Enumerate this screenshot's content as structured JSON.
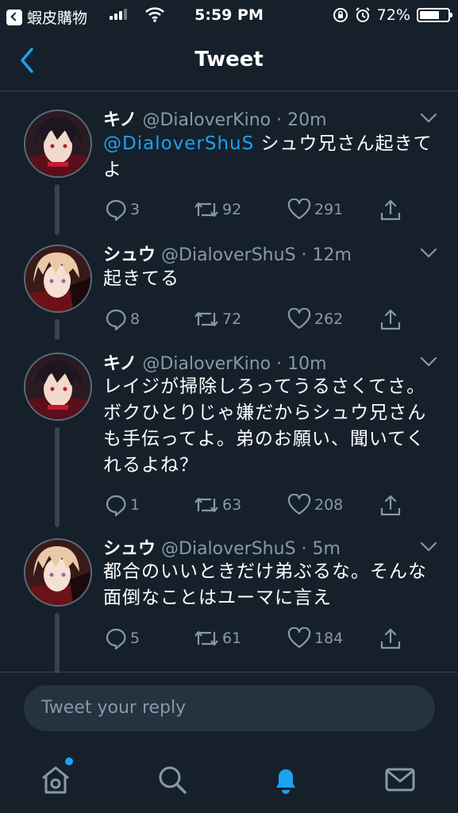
{
  "status_bar": {
    "back_app": "蝦皮購物",
    "time": "5:59 PM",
    "battery": "72%",
    "battery_level": 0.72
  },
  "header": {
    "title": "Tweet"
  },
  "tweets": [
    {
      "name": "キノ",
      "handle": "@DialoverKino",
      "time": "· 20m",
      "mention": "@DialoverShuS",
      "text": " シュウ兄さん起きてよ",
      "replies": "3",
      "retweets": "92",
      "likes": "291"
    },
    {
      "name": "シュウ",
      "handle": "@DialoverShuS",
      "time": "· 12m",
      "mention": "",
      "text": "起きてる",
      "replies": "8",
      "retweets": "72",
      "likes": "262"
    },
    {
      "name": "キノ",
      "handle": "@DialoverKino",
      "time": "· 10m",
      "mention": "",
      "text": "レイジが掃除しろってうるさくてさ。ボクひとりじゃ嫌だからシュウ兄さんも手伝ってよ。弟のお願い、聞いてくれるよね？",
      "replies": "1",
      "retweets": "63",
      "likes": "208"
    },
    {
      "name": "シュウ",
      "handle": "@DialoverShuS",
      "time": "· 5m",
      "mention": "",
      "text": "都合のいいときだけ弟ぶるな。そんな面倒なことはユーマに言え",
      "replies": "5",
      "retweets": "61",
      "likes": "184"
    }
  ],
  "reply": {
    "placeholder": "Tweet your reply"
  },
  "tabbar": {
    "items": [
      "home-icon",
      "search-icon",
      "notifications-icon",
      "messages-icon"
    ],
    "active": "notifications-icon"
  },
  "colors": {
    "background": "#15202b",
    "accent": "#1da1f2",
    "muted": "#8899a6",
    "divider": "#38444d"
  }
}
